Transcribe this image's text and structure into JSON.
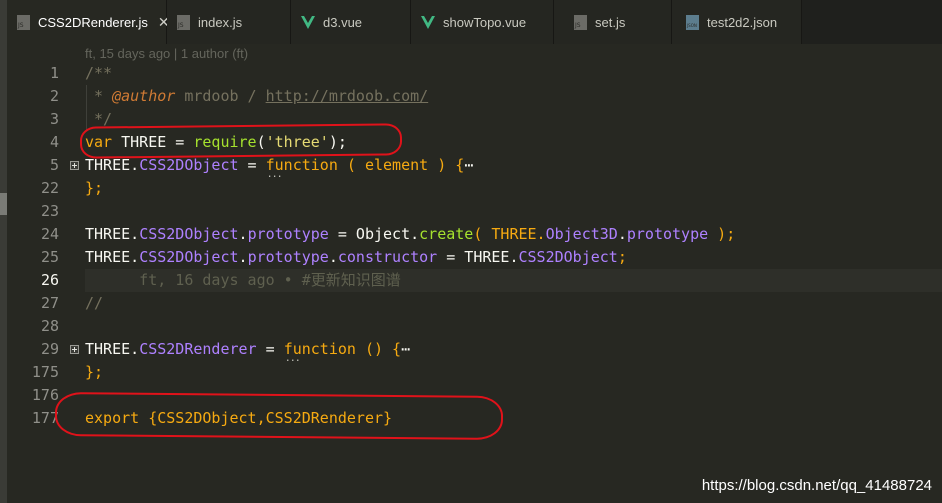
{
  "tabs": [
    {
      "label": "CSS2DRenderer.js",
      "icon": "js-file-icon",
      "active": true,
      "close": "✕"
    },
    {
      "label": "index.js",
      "icon": "js-file-icon",
      "active": false
    },
    {
      "label": "d3.vue",
      "icon": "vue-file-icon",
      "active": false
    },
    {
      "label": "showTopo.vue",
      "icon": "vue-file-icon",
      "active": false
    },
    {
      "label": "set.js",
      "icon": "js-file-icon",
      "active": false
    },
    {
      "label": "test2d2.json",
      "icon": "json-file-icon",
      "active": false
    }
  ],
  "file_icon_label": "JS",
  "json_icon_label": "JSON",
  "blame_header": "ft, 15 days ago | 1 author (ft)",
  "line_numbers": [
    "1",
    "2",
    "3",
    "4",
    "5",
    "22",
    "23",
    "24",
    "25",
    "26",
    "27",
    "28",
    "29",
    "175",
    "176",
    "177"
  ],
  "current_line": "26",
  "code": {
    "l1": "/**",
    "l2_a": " * ",
    "l2_author": "@author",
    "l2_b": " mrdoob / ",
    "l2_url": "http://mrdoob.com/",
    "l3": " */",
    "l4_var": "var",
    "l4_a": " THREE = ",
    "l4_require": "require",
    "l4_b": "(",
    "l4_str": "'three'",
    "l4_c": ");",
    "l5_a": "THREE.",
    "l5_cls": "CSS2DObject",
    "l5_b": " = ",
    "l5_fn": "function",
    "l5_c": " ( element ) {",
    "l5_ell": "⋯",
    "l22": "};",
    "l24_a": "THREE.",
    "l24_cls": "CSS2DObject",
    "l24_dot": ".",
    "l24_proto": "prototype",
    "l24_b": " = Object.",
    "l24_create": "create",
    "l24_c": "( THREE.",
    "l24_o3d": "Object3D",
    "l24_d": ".",
    "l24_proto2": "prototype",
    "l24_e": " );",
    "l25_a": "THREE.",
    "l25_cls": "CSS2DObject",
    "l25_dot": ".",
    "l25_proto": "prototype",
    "l25_dot2": ".",
    "l25_ctor": "constructor",
    "l25_b": " = THREE.",
    "l25_cls2": "CSS2DObject",
    "l25_c": ";",
    "l26_blame": "      ft, 16 days ago • #更新知识图谱",
    "l27": "//",
    "l29_a": "THREE.",
    "l29_cls": "CSS2DRenderer",
    "l29_b": " = ",
    "l29_fn": "function",
    "l29_c": " () {",
    "l29_ell": "⋯",
    "l175": "};",
    "l177_export": "export",
    "l177_a": " {CSS2DObject,CSS2DRenderer}"
  },
  "colors": {
    "background": "#272822",
    "keyword": "#f6aa11",
    "class_name": "#ae81ff",
    "string": "#e6db74",
    "comment": "#75715e",
    "annotation_red": "#e0121a"
  },
  "watermark": "https://blog.csdn.net/qq_41488724"
}
